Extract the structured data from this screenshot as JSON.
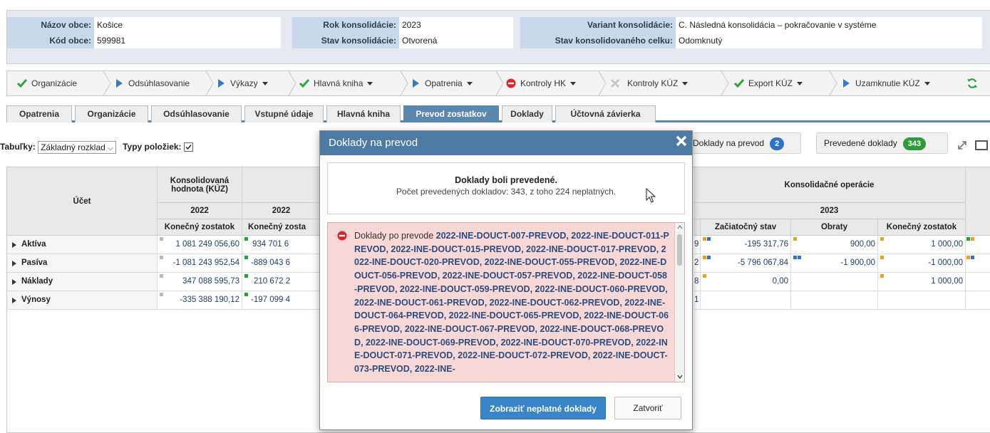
{
  "header": {
    "nazov_obce_label": "Názov obce:",
    "nazov_obce": "Košice",
    "kod_obce_label": "Kód obce:",
    "kod_obce": "599981",
    "rok_label": "Rok konsolidácie:",
    "rok": "2023",
    "stav_label": "Stav konsolidácie:",
    "stav": "Otvorená",
    "variant_label": "Variant konsolidácie:",
    "variant": "C. Následná konsolidácia – pokračovanie v systéme",
    "stav_celku_label": "Stav konsolidovaného celku:",
    "stav_celku": "Odomknutý"
  },
  "toolbar": {
    "organizacie": "Organizácie",
    "odsuhlasovanie": "Odsúhlasovanie",
    "vykazy": "Výkazy",
    "hlavna_kniha": "Hlavná kniha",
    "opatrenia": "Opatrenia",
    "kontroly_hk": "Kontroly HK",
    "kontroly_kuz": "Kontroly KÚZ",
    "export_kuz": "Export KÚZ",
    "uzamknutie_kuz": "Uzamknutie KÚZ"
  },
  "tabs": [
    "Opatrenia",
    "Organizácie",
    "Odsúhlasovanie",
    "Vstupné údaje",
    "Hlavná kniha",
    "Prevod zostatkov",
    "Doklady",
    "Účtovná závierka"
  ],
  "controls": {
    "tabulky_label": "Tabuľky:",
    "tabulky_value": "Základný rozklad",
    "typy_label": "Typy položiek:",
    "doklady_na_prevod": "Doklady na prevod",
    "doklady_na_prevod_count": "2",
    "prevedene_doklady": "Prevedené doklady",
    "prevedene_count": "343"
  },
  "table": {
    "ucet": "Účet",
    "konsolidovana": "Konsolidovaná hodnota (KÚZ)",
    "konsolidacne_operacie": "Konsolidačné operácie",
    "year_2022": "2022",
    "year_2023": "2023",
    "konecny_zostatok": "Konečný zostatok",
    "konecny_zost_cut": "Konečný zosta",
    "zaciatocny_stav": "Začiatočný stav",
    "obraty": "Obraty",
    "rows": [
      {
        "label": "Aktíva",
        "kuz": "1 081 249 056,60",
        "c2": "934 701 6",
        "edge": "9",
        "zac": "-195 317,76",
        "obr": "900,00",
        "kon": "1 000,00"
      },
      {
        "label": "Pasíva",
        "kuz": "-1 081 243 952,54",
        "c2": "-889 043 6",
        "edge": "2",
        "zac": "-5 796 067,84",
        "obr": "-1 900,00",
        "kon": "-1 000,00"
      },
      {
        "label": "Náklady",
        "kuz": "347 088 595,73",
        "c2": "210 672 2",
        "edge": "8",
        "zac": "0,00",
        "obr": "",
        "kon": "1 000,00"
      },
      {
        "label": "Výnosy",
        "kuz": "-335 388 190,12",
        "c2": "-197 099 4",
        "edge": "1",
        "zac": "",
        "obr": "",
        "kon": ""
      }
    ]
  },
  "modal": {
    "title": "Doklady na prevod",
    "info_title": "Doklady boli prevedené.",
    "info_sub": "Počet prevedených dokladov: 343, z toho 224 neplatných.",
    "err_prefix": "Doklady po prevode ",
    "err_list": "2022-INE-DOUCT-007-PREVOD, 2022-INE-DOUCT-011-PREVOD, 2022-INE-DOUCT-015-PREVOD, 2022-INE-DOUCT-017-PREVOD, 2022-INE-DOUCT-020-PREVOD, 2022-INE-DOUCT-055-PREVOD, 2022-INE-DOUCT-056-PREVOD, 2022-INE-DOUCT-057-PREVOD, 2022-INE-DOUCT-058-PREVOD, 2022-INE-DOUCT-059-PREVOD, 2022-INE-DOUCT-060-PREVOD, 2022-INE-DOUCT-061-PREVOD, 2022-INE-DOUCT-062-PREVOD, 2022-INE-DOUCT-064-PREVOD, 2022-INE-DOUCT-065-PREVOD, 2022-INE-DOUCT-066-PREVOD, 2022-INE-DOUCT-067-PREVOD, 2022-INE-DOUCT-068-PREVOD, 2022-INE-DOUCT-069-PREVOD, 2022-INE-DOUCT-070-PREVOD, 2022-INE-DOUCT-071-PREVOD, 2022-INE-DOUCT-072-PREVOD, 2022-INE-DOUCT-073-PREVOD, 2022-INE-",
    "show_invalid": "Zobraziť neplatné doklady",
    "close": "Zatvoriť"
  },
  "colors": {
    "accent": "#5b86ad",
    "modal_header": "#4e7ba4",
    "green": "#2aa33b",
    "error_bg": "#f8d7d7",
    "badge_blue": "#2f73c9",
    "badge_green": "#2e9b3a",
    "marker_orange": "#f0a020",
    "marker_blue": "#2f6fd6",
    "marker_green": "#22a63a",
    "marker_gray": "#b9b9b9"
  },
  "icons": [
    "check-icon",
    "play-icon",
    "stop-icon",
    "cross-icon",
    "refresh-icon",
    "close-icon",
    "expand-icon",
    "maximize-icon",
    "error-icon",
    "cursor-icon"
  ]
}
